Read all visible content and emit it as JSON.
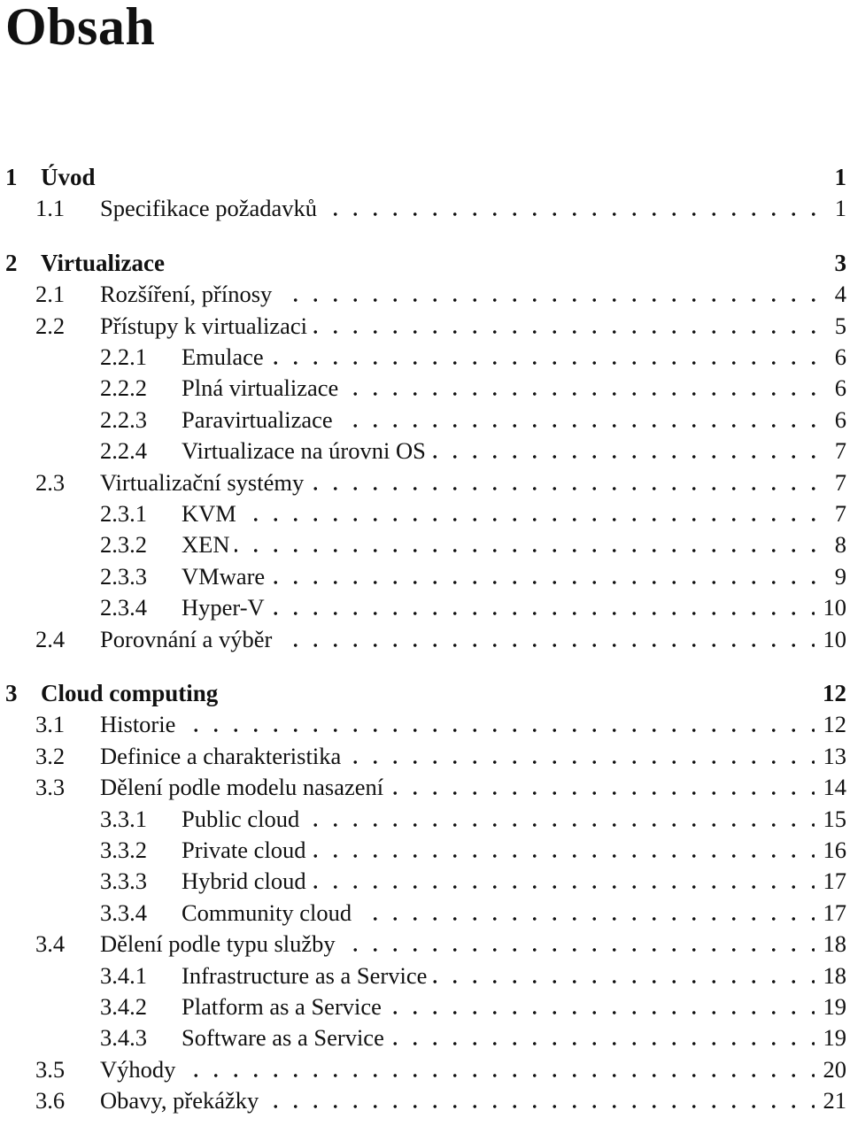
{
  "title": "Obsah",
  "entries": [
    {
      "level": 0,
      "num": "1",
      "label": "Úvod",
      "page": "1"
    },
    {
      "level": 1,
      "num": "1.1",
      "label": "Specifikace požadavků",
      "page": "1"
    },
    {
      "level": 0,
      "num": "2",
      "label": "Virtualizace",
      "page": "3"
    },
    {
      "level": 1,
      "num": "2.1",
      "label": "Rozšíření, přínosy",
      "page": "4"
    },
    {
      "level": 1,
      "num": "2.2",
      "label": "Přístupy k virtualizaci",
      "page": "5"
    },
    {
      "level": 2,
      "num": "2.2.1",
      "label": "Emulace",
      "page": "6"
    },
    {
      "level": 2,
      "num": "2.2.2",
      "label": "Plná virtualizace",
      "page": "6"
    },
    {
      "level": 2,
      "num": "2.2.3",
      "label": "Paravirtualizace",
      "page": "6"
    },
    {
      "level": 2,
      "num": "2.2.4",
      "label": "Virtualizace na úrovni OS",
      "page": "7"
    },
    {
      "level": 1,
      "num": "2.3",
      "label": "Virtualizační systémy",
      "page": "7"
    },
    {
      "level": 2,
      "num": "2.3.1",
      "label": "KVM",
      "page": "7"
    },
    {
      "level": 2,
      "num": "2.3.2",
      "label": "XEN",
      "page": "8"
    },
    {
      "level": 2,
      "num": "2.3.3",
      "label": "VMware",
      "page": "9"
    },
    {
      "level": 2,
      "num": "2.3.4",
      "label": "Hyper-V",
      "page": "10"
    },
    {
      "level": 1,
      "num": "2.4",
      "label": "Porovnání a výběr",
      "page": "10"
    },
    {
      "level": 0,
      "num": "3",
      "label": "Cloud computing",
      "page": "12"
    },
    {
      "level": 1,
      "num": "3.1",
      "label": "Historie",
      "page": "12"
    },
    {
      "level": 1,
      "num": "3.2",
      "label": "Definice a charakteristika",
      "page": "13"
    },
    {
      "level": 1,
      "num": "3.3",
      "label": "Dělení podle modelu nasazení",
      "page": "14"
    },
    {
      "level": 2,
      "num": "3.3.1",
      "label": "Public cloud",
      "page": "15"
    },
    {
      "level": 2,
      "num": "3.3.2",
      "label": "Private cloud",
      "page": "16"
    },
    {
      "level": 2,
      "num": "3.3.3",
      "label": "Hybrid cloud",
      "page": "17"
    },
    {
      "level": 2,
      "num": "3.3.4",
      "label": "Community cloud",
      "page": "17"
    },
    {
      "level": 1,
      "num": "3.4",
      "label": "Dělení podle typu služby",
      "page": "18"
    },
    {
      "level": 2,
      "num": "3.4.1",
      "label": "Infrastructure as a Service",
      "page": "18"
    },
    {
      "level": 2,
      "num": "3.4.2",
      "label": "Platform as a Service",
      "page": "19"
    },
    {
      "level": 2,
      "num": "3.4.3",
      "label": "Software as a Service",
      "page": "19"
    },
    {
      "level": 1,
      "num": "3.5",
      "label": "Výhody",
      "page": "20"
    },
    {
      "level": 1,
      "num": "3.6",
      "label": "Obavy, překážky",
      "page": "21"
    }
  ]
}
